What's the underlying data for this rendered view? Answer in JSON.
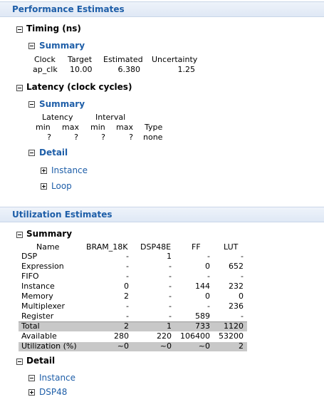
{
  "performance": {
    "title": "Performance Estimates",
    "timing": {
      "title": "Timing (ns)",
      "summary_title": "Summary",
      "headers": [
        "Clock",
        "Target",
        "Estimated",
        "Uncertainty"
      ],
      "row": [
        "ap_clk",
        "10.00",
        "6.380",
        "1.25"
      ]
    },
    "latency": {
      "title": "Latency (clock cycles)",
      "summary_title": "Summary",
      "group_latency": "Latency",
      "group_interval": "Interval",
      "headers": [
        "min",
        "max",
        "min",
        "max",
        "Type"
      ],
      "row": [
        "?",
        "?",
        "?",
        "?",
        "none"
      ],
      "detail_title": "Detail",
      "instance": "Instance",
      "loop": "Loop"
    }
  },
  "utilization": {
    "title": "Utilization Estimates",
    "summary_title": "Summary",
    "headers": [
      "Name",
      "BRAM_18K",
      "DSP48E",
      "FF",
      "LUT"
    ],
    "rows": [
      [
        "DSP",
        "-",
        "1",
        "-",
        "-"
      ],
      [
        "Expression",
        "-",
        "-",
        "0",
        "652"
      ],
      [
        "FIFO",
        "-",
        "-",
        "-",
        "-"
      ],
      [
        "Instance",
        "0",
        "-",
        "144",
        "232"
      ],
      [
        "Memory",
        "2",
        "-",
        "0",
        "0"
      ],
      [
        "Multiplexer",
        "-",
        "-",
        "-",
        "236"
      ],
      [
        "Register",
        "-",
        "-",
        "589",
        "-"
      ],
      [
        "Total",
        "2",
        "1",
        "733",
        "1120"
      ],
      [
        "Available",
        "280",
        "220",
        "106400",
        "53200"
      ],
      [
        "Utilization (%)",
        "~0",
        "~0",
        "~0",
        "2"
      ]
    ],
    "detail_title": "Detail",
    "instance": "Instance",
    "dsp48": "DSP48"
  }
}
